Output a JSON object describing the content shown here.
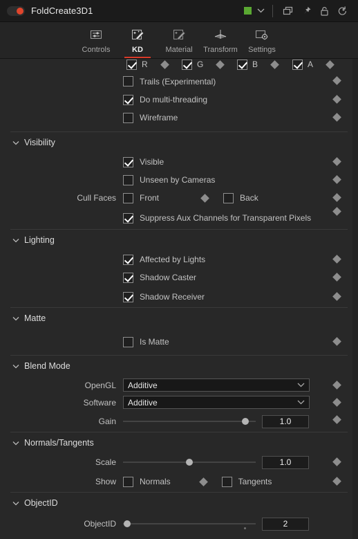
{
  "titlebar": {
    "enable_toggle": "node-enable-toggle",
    "node_name": "FoldCreate3D1",
    "color_swatch": "#5aa832",
    "icons": [
      "color-chevron-down-icon",
      "duplicate-icon",
      "pin-icon",
      "lock-icon",
      "reset-icon"
    ]
  },
  "tabs": [
    {
      "label": "Controls",
      "icon": "sliders-icon",
      "active": false
    },
    {
      "label": "KD",
      "icon": "magic-wand-icon",
      "active": true
    },
    {
      "label": "Material",
      "icon": "material-wand-icon",
      "active": false
    },
    {
      "label": "Transform",
      "icon": "axis-gizmo-icon",
      "active": false
    },
    {
      "label": "Settings",
      "icon": "gear-panel-icon",
      "active": false
    }
  ],
  "accent_color": "#d93a28",
  "channels": {
    "items": [
      {
        "label": "R",
        "checked": true
      },
      {
        "label": "G",
        "checked": true
      },
      {
        "label": "B",
        "checked": true
      },
      {
        "label": "A",
        "checked": true
      }
    ]
  },
  "top_options": [
    {
      "label": "Trails (Experimental)",
      "checked": false
    },
    {
      "label": "Do multi-threading",
      "checked": true
    },
    {
      "label": "Wireframe",
      "checked": false
    }
  ],
  "sections": {
    "visibility": {
      "title": "Visibility",
      "expanded": true,
      "checkboxes": [
        {
          "label": "Visible",
          "checked": true
        },
        {
          "label": "Unseen by Cameras",
          "checked": false
        }
      ],
      "cull_faces": {
        "label": "Cull Faces",
        "front": {
          "label": "Front",
          "checked": false
        },
        "back": {
          "label": "Back",
          "checked": false
        }
      },
      "suppress": {
        "label": "Suppress Aux Channels for Transparent Pixels",
        "checked": true
      }
    },
    "lighting": {
      "title": "Lighting",
      "expanded": true,
      "checkboxes": [
        {
          "label": "Affected by Lights",
          "checked": true
        },
        {
          "label": "Shadow Caster",
          "checked": true
        },
        {
          "label": "Shadow Receiver",
          "checked": true
        }
      ]
    },
    "matte": {
      "title": "Matte",
      "expanded": true,
      "checkboxes": [
        {
          "label": "Is Matte",
          "checked": false
        }
      ]
    },
    "blend_mode": {
      "title": "Blend Mode",
      "expanded": true,
      "opengl": {
        "label": "OpenGL",
        "value": "Additive"
      },
      "software": {
        "label": "Software",
        "value": "Additive"
      },
      "gain": {
        "label": "Gain",
        "value": "1.0",
        "percent": 92
      }
    },
    "normals_tangents": {
      "title": "Normals/Tangents",
      "expanded": true,
      "scale": {
        "label": "Scale",
        "value": "1.0",
        "percent": 50
      },
      "show": {
        "label": "Show",
        "normals": {
          "label": "Normals",
          "checked": false
        },
        "tangents": {
          "label": "Tangents",
          "checked": false
        }
      }
    },
    "objectid": {
      "title": "ObjectID",
      "expanded": true,
      "objectid": {
        "label": "ObjectID",
        "value": "2",
        "percent": 3,
        "default_percent": 92
      }
    }
  }
}
